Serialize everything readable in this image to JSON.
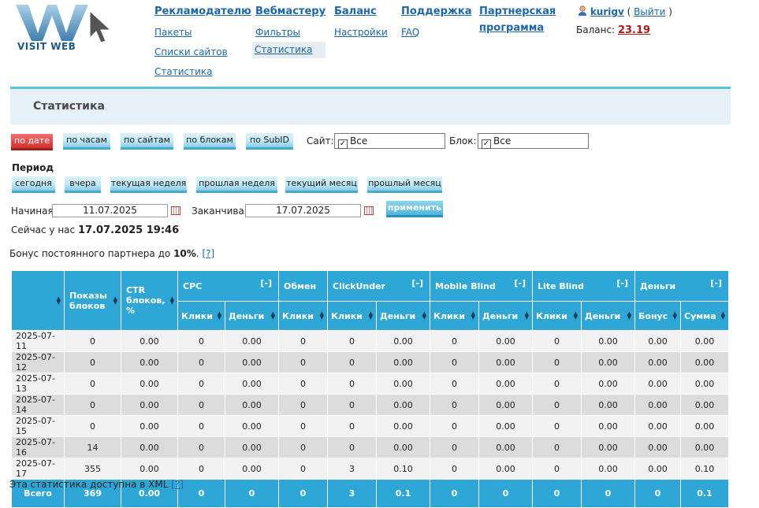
{
  "logo": {
    "text": "VISIT WEB"
  },
  "nav": {
    "advertiser": {
      "label": "Рекламодателю",
      "items": [
        "Пакеты",
        "Списки сайтов",
        "Статистика"
      ]
    },
    "webmaster": {
      "label": "Вебмастеру",
      "items": [
        "Фильтры",
        "Статистика"
      ]
    },
    "balance": {
      "label": "Баланс",
      "items": [
        "Настройки"
      ]
    },
    "support": {
      "label": "Поддержка",
      "items": [
        "FAQ"
      ]
    },
    "partner": {
      "label_line1": "Партнерская",
      "label_line2": "программа"
    }
  },
  "user": {
    "name": "kurigv",
    "logout": "Выйти",
    "balance_label": "Баланс:",
    "balance_value": "23.19"
  },
  "page_title": "Статистика",
  "group_buttons": [
    "по дате",
    "по часам",
    "по сайтам",
    "по блокам",
    "по SubID"
  ],
  "site_filter": {
    "label": "Сайт:",
    "value": "Все"
  },
  "block_filter": {
    "label": "Блок:",
    "value": "Все"
  },
  "period": {
    "label": "Период",
    "buttons": [
      "сегодня",
      "вчера",
      "текущая неделя",
      "прошлая неделя",
      "текущий месяц",
      "прошлый месяц"
    ],
    "start_label": "Начиная",
    "start_value": "11.07.2025",
    "end_label": "Заканчивая",
    "end_value": "17.07.2025",
    "apply": "применить"
  },
  "now": {
    "label": "Сейчас у нас",
    "value": "17.07.2025 19:46"
  },
  "bonus": {
    "text": "Бонус постоянного партнера до",
    "value": "10%",
    "help": "[?]"
  },
  "table": {
    "top_headers": {
      "shows": "Показы блоков",
      "ctr": "CTR блоков, %",
      "cpc": "CPC",
      "exchange": "Обмен",
      "clickunder": "ClickUnder",
      "mobile": "Mobile Blind",
      "lite": "Lite Blind",
      "money": "Деньги"
    },
    "collapse": "[-]",
    "sub_headers": [
      "Клики",
      "Деньги",
      "Клики",
      "Клики",
      "Деньги",
      "Клики",
      "Деньги",
      "Клики",
      "Деньги",
      "Бонус",
      "Сумма"
    ],
    "rows": [
      [
        "2025-07-11",
        "0",
        "0.00",
        "0",
        "0.00",
        "0",
        "0",
        "0.00",
        "0",
        "0.00",
        "0",
        "0.00",
        "0.00",
        "0.00"
      ],
      [
        "2025-07-12",
        "0",
        "0.00",
        "0",
        "0.00",
        "0",
        "0",
        "0.00",
        "0",
        "0.00",
        "0",
        "0.00",
        "0.00",
        "0.00"
      ],
      [
        "2025-07-13",
        "0",
        "0.00",
        "0",
        "0.00",
        "0",
        "0",
        "0.00",
        "0",
        "0.00",
        "0",
        "0.00",
        "0.00",
        "0.00"
      ],
      [
        "2025-07-14",
        "0",
        "0.00",
        "0",
        "0.00",
        "0",
        "0",
        "0.00",
        "0",
        "0.00",
        "0",
        "0.00",
        "0.00",
        "0.00"
      ],
      [
        "2025-07-15",
        "0",
        "0.00",
        "0",
        "0.00",
        "0",
        "0",
        "0.00",
        "0",
        "0.00",
        "0",
        "0.00",
        "0.00",
        "0.00"
      ],
      [
        "2025-07-16",
        "14",
        "0.00",
        "0",
        "0.00",
        "0",
        "0",
        "0.00",
        "0",
        "0.00",
        "0",
        "0.00",
        "0.00",
        "0.00"
      ],
      [
        "2025-07-17",
        "355",
        "0.00",
        "0",
        "0.00",
        "0",
        "3",
        "0.10",
        "0",
        "0.00",
        "0",
        "0.00",
        "0.00",
        "0.10"
      ]
    ],
    "totals": [
      "Всего",
      "369",
      "0.00",
      "0",
      "0",
      "0",
      "3",
      "0.1",
      "0",
      "0",
      "0",
      "0",
      "0",
      "0.1"
    ]
  },
  "xml": {
    "text": "Эта статистика доступна в XML",
    "help": "[?]"
  }
}
